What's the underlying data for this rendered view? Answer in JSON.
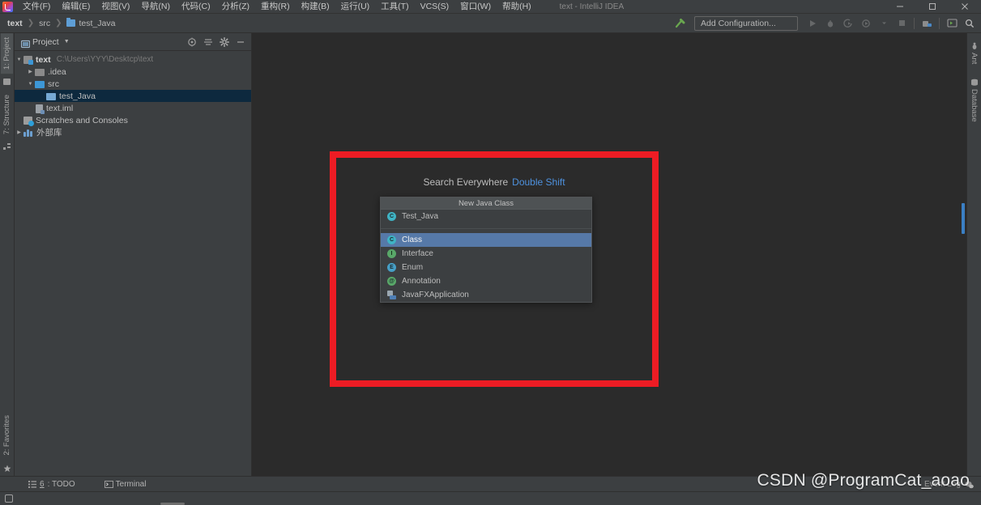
{
  "window": {
    "title": "text - IntelliJ IDEA",
    "controls": {
      "minimize": "—",
      "maximize": "❐",
      "close": "✕"
    }
  },
  "menubar": [
    {
      "label": "文件(F)",
      "name": "file"
    },
    {
      "label": "编辑(E)",
      "name": "edit"
    },
    {
      "label": "视图(V)",
      "name": "view"
    },
    {
      "label": "导航(N)",
      "name": "navigate"
    },
    {
      "label": "代码(C)",
      "name": "code"
    },
    {
      "label": "分析(Z)",
      "name": "analyze"
    },
    {
      "label": "重构(R)",
      "name": "refactor"
    },
    {
      "label": "构建(B)",
      "name": "build"
    },
    {
      "label": "运行(U)",
      "name": "run"
    },
    {
      "label": "工具(T)",
      "name": "tools"
    },
    {
      "label": "VCS(S)",
      "name": "vcs"
    },
    {
      "label": "窗口(W)",
      "name": "window"
    },
    {
      "label": "帮助(H)",
      "name": "help"
    }
  ],
  "breadcrumb": [
    {
      "label": "text",
      "bold": true
    },
    {
      "label": "src",
      "bold": false
    },
    {
      "label": "test_Java",
      "bold": false,
      "icon": "package-folder-icon"
    }
  ],
  "toolbar": {
    "build_label": "build-hammer-icon",
    "configuration_selector": "Add Configuration...",
    "run_label": "run-icon",
    "debug_label": "debug-icon",
    "run_with_coverage_label": "run-coverage-icon",
    "profile_label": "profile-icon",
    "stop_label": "stop-icon",
    "build_project_label": "build-project-icon",
    "update_label": "update-icon",
    "search_label": "search-everywhere-icon"
  },
  "left_stripe": {
    "top": [
      {
        "label": "1: Project",
        "name": "project",
        "active": true
      },
      {
        "label": "7: Structure",
        "name": "structure",
        "active": false
      }
    ],
    "bottom": [
      {
        "label": "2: Favorites",
        "name": "favorites",
        "active": false
      }
    ]
  },
  "right_stripe": {
    "items": [
      {
        "label": "Ant",
        "name": "ant"
      },
      {
        "label": "Database",
        "name": "database"
      }
    ]
  },
  "project_panel": {
    "title": "Project",
    "icons": [
      "locate-icon",
      "collapse-all-icon",
      "settings-gear-icon",
      "hide-icon"
    ],
    "tree": [
      {
        "label": "text",
        "path": "C:\\Users\\YYY\\Desktcp\\text",
        "indent": 0,
        "arrow": "▼",
        "icon": "module-icon",
        "bold": true,
        "selected": false
      },
      {
        "label": ".idea",
        "path": "",
        "indent": 1,
        "arrow": "▶",
        "icon": "folder-icon",
        "bold": false,
        "selected": false
      },
      {
        "label": "src",
        "path": "",
        "indent": 1,
        "arrow": "▼",
        "icon": "source-folder-icon",
        "bold": false,
        "selected": false
      },
      {
        "label": "test_Java",
        "path": "",
        "indent": 2,
        "arrow": "",
        "icon": "package-folder-icon",
        "bold": false,
        "selected": true
      },
      {
        "label": "text.iml",
        "path": "",
        "indent": 1,
        "arrow": "",
        "icon": "iml-file-icon",
        "bold": false,
        "selected": false
      },
      {
        "label": "Scratches and Consoles",
        "path": "",
        "indent": 0,
        "arrow": "",
        "icon": "scratches-icon",
        "bold": false,
        "selected": false
      },
      {
        "label": "外部库",
        "path": "",
        "indent": 0,
        "arrow": "▶",
        "icon": "library-icon",
        "bold": false,
        "selected": false
      }
    ]
  },
  "search_everywhere": {
    "hint_text": "Search Everywhere",
    "hint_shortcut": "Double Shift",
    "hint_shortcut_color": "#4e92df"
  },
  "popup": {
    "header": "New Java Class",
    "name_entry": {
      "label": "Test_Java",
      "icon": "class-icon"
    },
    "options": [
      {
        "label": "Class",
        "icon": "class-icon",
        "selected": true
      },
      {
        "label": "Interface",
        "icon": "interface-icon",
        "selected": false
      },
      {
        "label": "Enum",
        "icon": "enum-icon",
        "selected": false
      },
      {
        "label": "Annotation",
        "icon": "annotation-icon",
        "selected": false
      },
      {
        "label": "JavaFXApplication",
        "icon": "javafx-icon",
        "selected": false
      }
    ],
    "selection_color": "#5679a8"
  },
  "annotation": {
    "shape": "rectangle",
    "color": "#ed1c24"
  },
  "bottom_tabs": [
    {
      "num": "6",
      "label": ": TODO",
      "name": "todo",
      "icon": "todo-icon"
    },
    {
      "num": "",
      "label": "Terminal",
      "name": "terminal",
      "icon": "terminal-icon"
    }
  ],
  "status_bar": {
    "event_log": "Event Log",
    "left_icon": "layout-icon"
  },
  "watermark": "CSDN @ProgramCat_aoao"
}
